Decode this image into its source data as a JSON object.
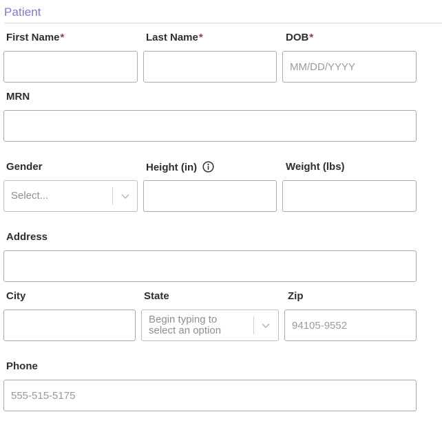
{
  "section": {
    "title": "Patient"
  },
  "fields": {
    "first_name": {
      "label": "First Name",
      "required_mark": "*",
      "value": ""
    },
    "last_name": {
      "label": "Last Name",
      "required_mark": "*",
      "value": ""
    },
    "dob": {
      "label": "DOB",
      "required_mark": "*",
      "placeholder": "MM/DD/YYYY",
      "value": ""
    },
    "mrn": {
      "label": "MRN",
      "value": ""
    },
    "gender": {
      "label": "Gender",
      "placeholder": "Select..."
    },
    "height": {
      "label": "Height (in)",
      "icon": "info-icon",
      "value": ""
    },
    "weight": {
      "label": "Weight (lbs)",
      "value": ""
    },
    "address": {
      "label": "Address",
      "value": ""
    },
    "city": {
      "label": "City",
      "value": ""
    },
    "state": {
      "label": "State",
      "placeholder": "Begin typing to\nselect an option"
    },
    "zip": {
      "label": "Zip",
      "placeholder": "94105-9552",
      "value": ""
    },
    "phone": {
      "label": "Phone",
      "placeholder": "555-515-5175",
      "value": ""
    }
  },
  "colors": {
    "section_title": "#7a78d8",
    "required": "#c9263a",
    "border": "#a9a9a9",
    "placeholder": "#9a9a9a"
  }
}
